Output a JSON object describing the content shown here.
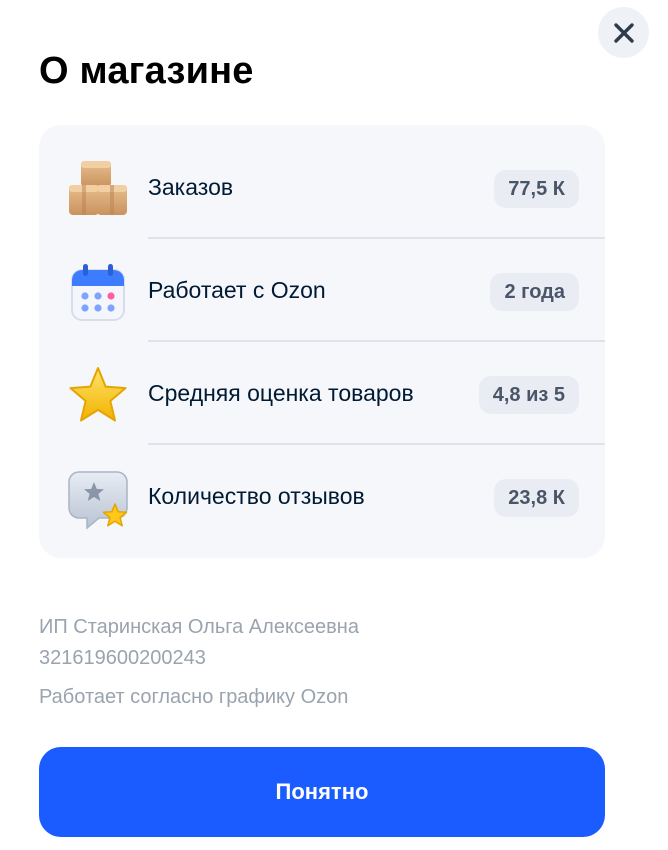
{
  "header": {
    "title": "О магазине",
    "close_icon": "close-icon"
  },
  "stats": [
    {
      "label": "Заказов",
      "value": "77,5 К",
      "icon": "boxes-icon"
    },
    {
      "label": "Работает с Ozon",
      "value": "2 года",
      "icon": "calendar-icon"
    },
    {
      "label": "Средняя оценка товаров",
      "value": "4,8 из 5",
      "icon": "star-icon"
    },
    {
      "label": "Количество отзывов",
      "value": "23,8 К",
      "icon": "review-icon"
    }
  ],
  "seller": {
    "name": "ИП Старинская Ольга Алексеевна",
    "ogrnip": "321619600200243",
    "schedule": "Работает согласно графику Ozon"
  },
  "actions": {
    "ok_label": "Понятно"
  },
  "colors": {
    "accent": "#1a5cff",
    "card_bg": "#f5f7fb",
    "badge_bg": "#e9edf3",
    "muted_text": "#9aa3ae"
  }
}
